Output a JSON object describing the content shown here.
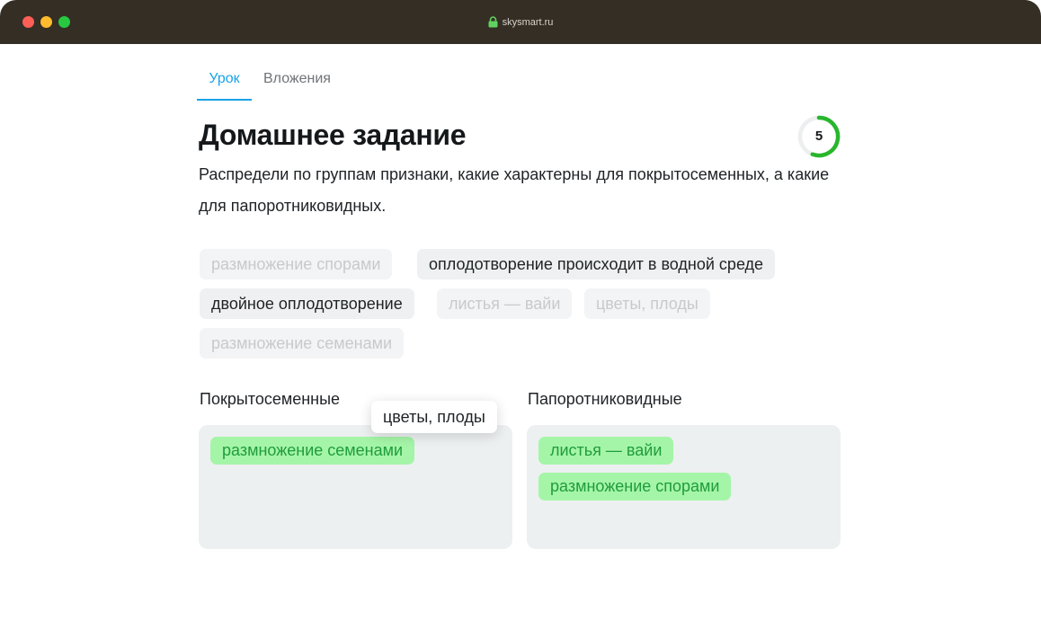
{
  "browser": {
    "url": "skysmart.ru"
  },
  "tabs": [
    {
      "label": "Урок",
      "active": true
    },
    {
      "label": "Вложения",
      "active": false
    }
  ],
  "task": {
    "title": "Домашнее задание",
    "score": "5",
    "description": "Распредели по группам признаки, какие характерны для покрытосеменных, а какие для папоротниковидных."
  },
  "pool": [
    {
      "label": "размножение спорами",
      "state": "used"
    },
    {
      "label": "оплодотворение происходит в водной среде",
      "state": "available"
    },
    {
      "label": "двойное оплодотворение",
      "state": "available"
    },
    {
      "label": "листья — вайи",
      "state": "used"
    },
    {
      "label": "цветы, плоды",
      "state": "used"
    },
    {
      "label": "размножение семенами",
      "state": "used"
    }
  ],
  "dragging": {
    "label": "цветы, плоды"
  },
  "groups": [
    {
      "label": "Покрытосеменные",
      "items": [
        "размножение семенами"
      ]
    },
    {
      "label": "Папоротниковидные",
      "items": [
        "листья — вайи",
        "размножение спорами"
      ]
    }
  ],
  "colors": {
    "accent": "#1aa3e8",
    "placed_bg": "#a5f5a8",
    "placed_text": "#1f9d3c",
    "progress": "#28b62c"
  }
}
